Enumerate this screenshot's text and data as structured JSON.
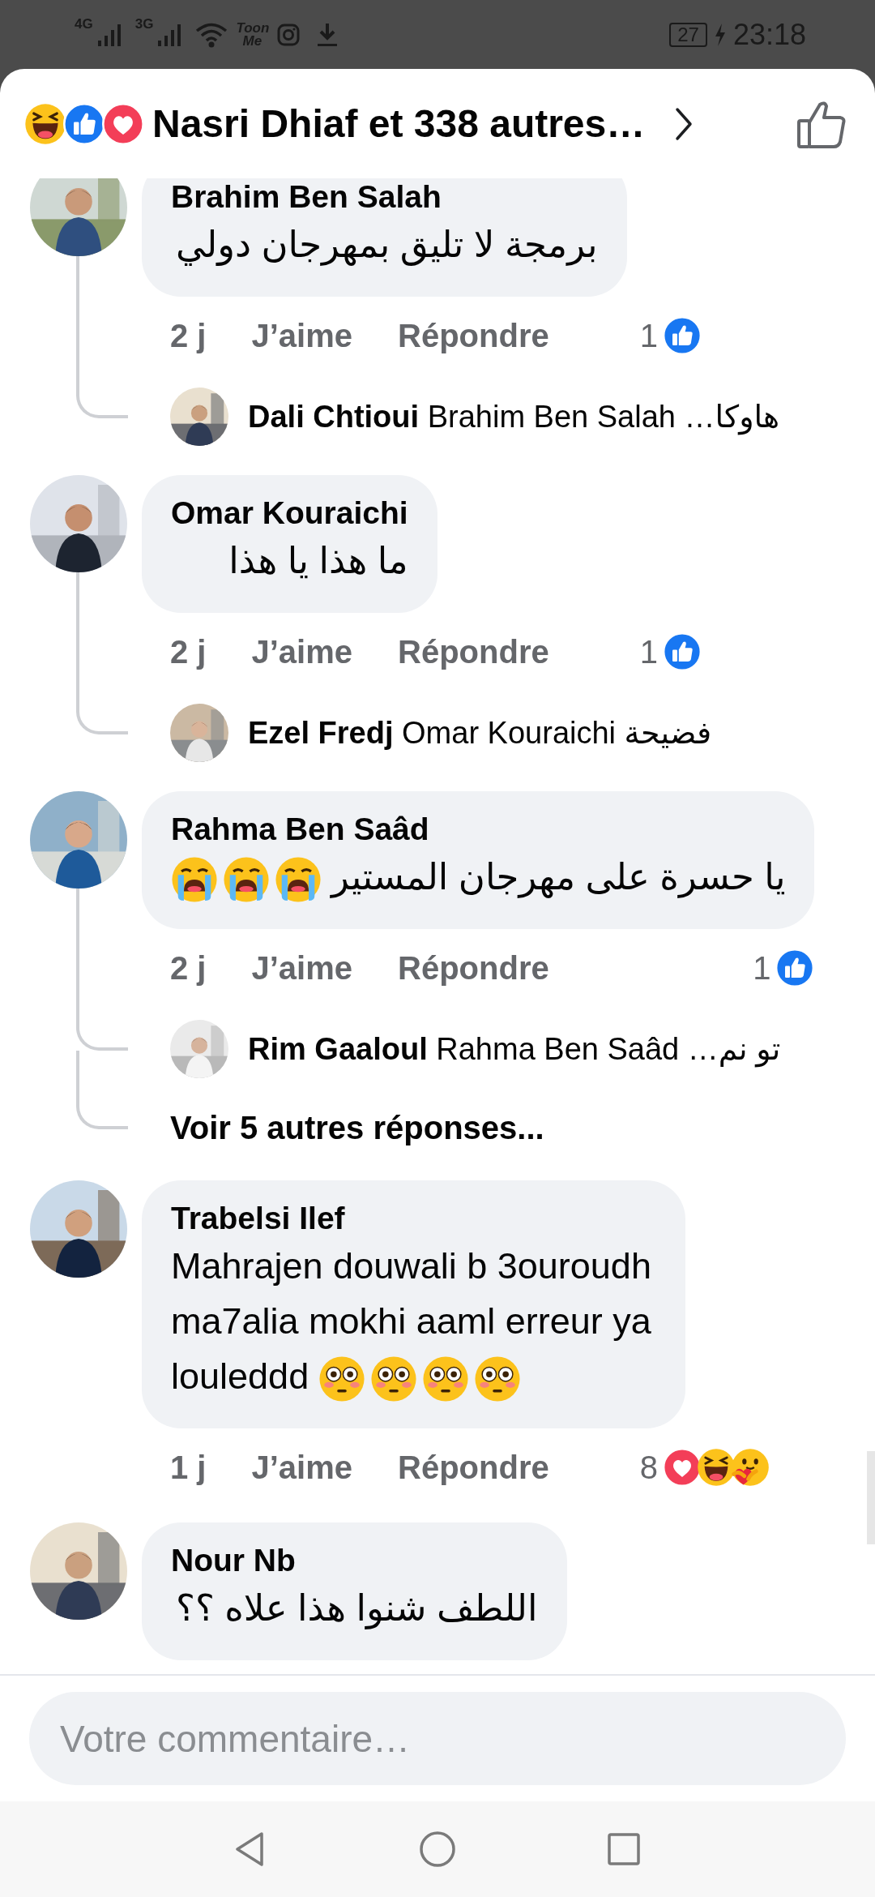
{
  "status_bar": {
    "network_1": "4G",
    "network_2": "3G",
    "app_label": "Toon Me",
    "battery": "27",
    "time": "23:18"
  },
  "header": {
    "title": "Nasri Dhiaf et 338 autres…"
  },
  "comments": [
    {
      "author": "Brahim Ben Salah",
      "text_lines": [
        "برمجة لا تليق بمهرجان دولي"
      ],
      "time": "2 j",
      "like_label": "J’aime",
      "reply_label": "Répondre",
      "reaction_count": "1",
      "replies": [
        {
          "author": "Dali Chtioui",
          "text": "Brahim Ben Salah …هاوكا"
        }
      ]
    },
    {
      "author": "Omar Kouraichi",
      "text_lines": [
        "ما هذا يا هذا"
      ],
      "time": "2 j",
      "like_label": "J’aime",
      "reply_label": "Répondre",
      "reaction_count": "1",
      "replies": [
        {
          "author": "Ezel Fredj",
          "text": "Omar Kouraichi فضيحة"
        }
      ]
    },
    {
      "author": "Rahma Ben Saâd",
      "text_lines": [
        "يا حسرة على مهرجان المستير"
      ],
      "time": "2 j",
      "like_label": "J’aime",
      "reply_label": "Répondre",
      "reaction_count": "1",
      "replies": [
        {
          "author": "Rim Gaaloul",
          "text": "Rahma Ben Saâd …تو نم"
        }
      ],
      "more_replies": "Voir 5 autres réponses..."
    },
    {
      "author": "Trabelsi Ilef",
      "text_lines": [
        "Mahrajen douwali b 3ouroudh",
        "ma7alia mokhi aaml erreur ya",
        "louleddd"
      ],
      "time": "1 j",
      "like_label": "J’aime",
      "reply_label": "Répondre",
      "reaction_count": "8"
    },
    {
      "author": "Nour Nb",
      "text_lines": [
        "اللطف شنوا هذا علاه ؟؟"
      ]
    }
  ],
  "composer": {
    "placeholder": "Votre commentaire…"
  }
}
